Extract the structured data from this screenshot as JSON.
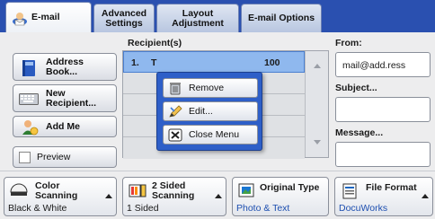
{
  "tabs": [
    {
      "label": "E-mail"
    },
    {
      "label": "Advanced Settings",
      "line1": "Advanced",
      "line2": "Settings"
    },
    {
      "label": "Layout Adjustment",
      "line1": "Layout",
      "line2": "Adjustment"
    },
    {
      "label": "E-mail Options"
    }
  ],
  "left_buttons": {
    "address_book": {
      "line1": "Address",
      "line2": "Book..."
    },
    "new_recipient": {
      "line1": "New",
      "line2": "Recipient..."
    },
    "add_me": "Add Me",
    "preview": "Preview"
  },
  "recipients": {
    "header": "Recipient(s)",
    "rows": [
      {
        "num": "1.",
        "prefix": "T",
        "suffix": "100"
      }
    ]
  },
  "popup_menu": {
    "items": [
      "Remove",
      "Edit...",
      "Close Menu"
    ]
  },
  "right_fields": {
    "from_label": "From:",
    "from_value": "mail@add.ress",
    "subject_label": "Subject...",
    "subject_value": "",
    "message_label": "Message...",
    "message_value": ""
  },
  "features": [
    {
      "line1": "Color",
      "line2": "Scanning",
      "value": "Black & White",
      "value_blue": false
    },
    {
      "line1": "2 Sided",
      "line2": "Scanning",
      "value": "1 Sided",
      "value_blue": false
    },
    {
      "line1": "Original Type",
      "line2": "",
      "value": "Photo & Text",
      "value_blue": true
    },
    {
      "line1": "File Format",
      "line2": "",
      "value": "DocuWorks",
      "value_blue": true
    }
  ],
  "colors": {
    "tab_bar": "#2a50b0",
    "selected_row": "#8fb8ee",
    "popup": "#2e5fc8",
    "value_blue": "#1d4fb0"
  }
}
